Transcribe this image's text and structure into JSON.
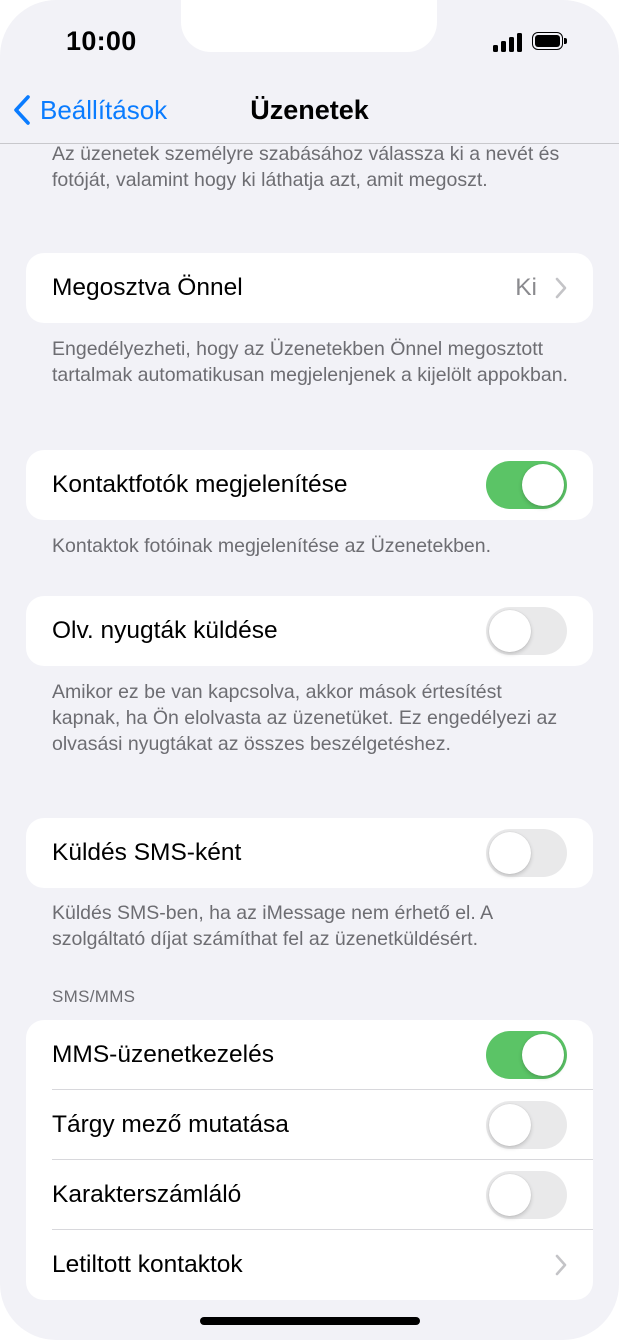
{
  "status_bar": {
    "time": "10:00"
  },
  "nav": {
    "back_label": "Beállítások",
    "title": "Üzenetek"
  },
  "intro_text": "Az üzenetek személyre szabásához válassza ki a nevét és fotóját, valamint hogy ki láthatja azt, amit megoszt.",
  "shared": {
    "label": "Megosztva Önnel",
    "value": "Ki",
    "footer": "Engedélyezheti, hogy az Üzenetekben Önnel megosztott tartalmak automatikusan megjelenjenek a kijelölt appokban."
  },
  "contact_photos": {
    "label": "Kontaktfotók megjelenítése",
    "on": true,
    "footer": "Kontaktok fotóinak megjelenítése az Üzenetekben."
  },
  "read_receipts": {
    "label": "Olv. nyugták küldése",
    "on": false,
    "footer": "Amikor ez be van kapcsolva, akkor mások értesítést kapnak, ha Ön elolvasta az üzenetüket. Ez engedélyezi az olvasási nyugtákat az összes beszélgetéshez."
  },
  "send_sms": {
    "label": "Küldés SMS-ként",
    "on": false,
    "footer": "Küldés SMS-ben, ha az iMessage nem érhető el. A szolgáltató díjat számíthat fel az üzenetküldésért."
  },
  "sms_section": {
    "header": "SMS/MMS",
    "items": [
      {
        "label": "MMS-üzenetkezelés",
        "type": "toggle",
        "on": true
      },
      {
        "label": "Tárgy mező mutatása",
        "type": "toggle",
        "on": false
      },
      {
        "label": "Karakterszámláló",
        "type": "toggle",
        "on": false
      },
      {
        "label": "Letiltott kontaktok",
        "type": "chevron"
      }
    ]
  },
  "colors": {
    "accent": "#0a7cff",
    "toggle_on": "#5bc466",
    "toggle_off": "#e9e9ea",
    "background": "#f2f2f7"
  }
}
